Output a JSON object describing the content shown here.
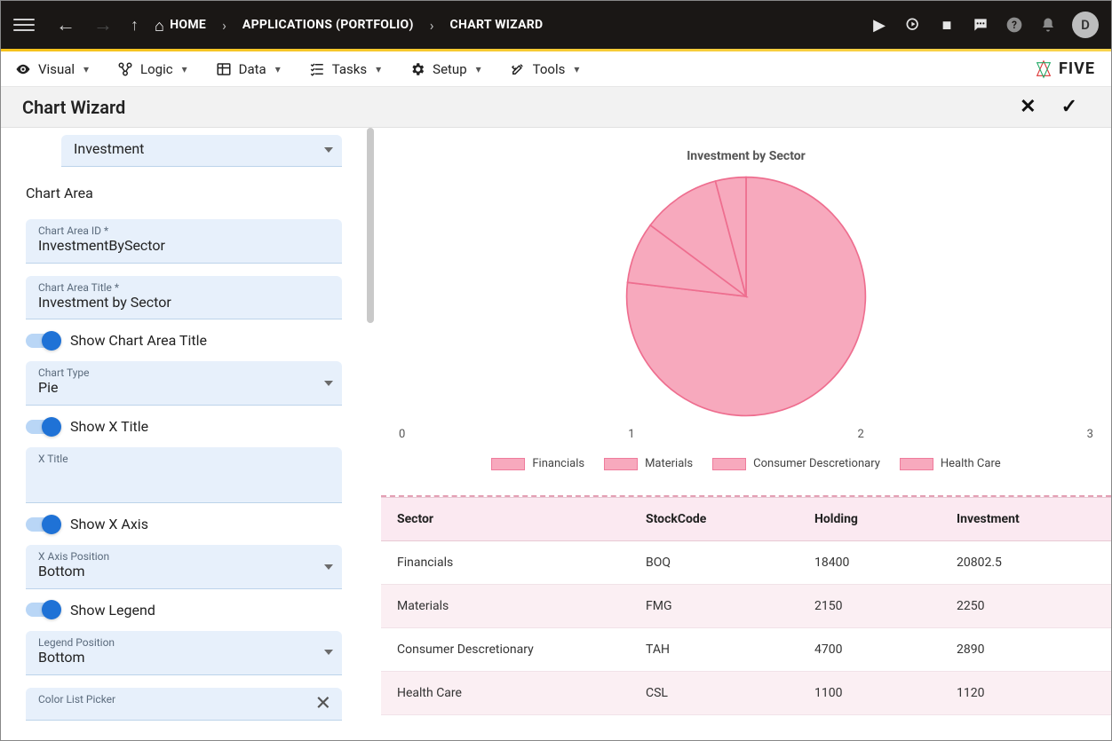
{
  "topnav": {
    "breadcrumbs": [
      {
        "label": "HOME",
        "icon": "home"
      },
      {
        "label": "APPLICATIONS (PORTFOLIO)"
      },
      {
        "label": "CHART WIZARD"
      }
    ],
    "avatar_initial": "D"
  },
  "toolbar": {
    "items": [
      {
        "label": "Visual"
      },
      {
        "label": "Logic"
      },
      {
        "label": "Data"
      },
      {
        "label": "Tasks"
      },
      {
        "label": "Setup"
      },
      {
        "label": "Tools"
      }
    ],
    "logo_text": "FIVE"
  },
  "page": {
    "title": "Chart Wizard"
  },
  "form": {
    "dataset_value": "Investment",
    "section_label": "Chart Area",
    "chart_area_id": {
      "label": "Chart Area ID *",
      "value": "InvestmentBySector"
    },
    "chart_area_title": {
      "label": "Chart Area Title *",
      "value": "Investment by Sector"
    },
    "show_chart_area_title_label": "Show Chart Area Title",
    "chart_type": {
      "label": "Chart Type",
      "value": "Pie"
    },
    "show_x_title_label": "Show X Title",
    "x_title": {
      "label": "X Title",
      "value": ""
    },
    "show_x_axis_label": "Show X Axis",
    "x_axis_position": {
      "label": "X Axis Position",
      "value": "Bottom"
    },
    "show_legend_label": "Show Legend",
    "legend_position": {
      "label": "Legend Position",
      "value": "Bottom"
    },
    "color_list_picker": {
      "label": "Color List Picker",
      "value": ""
    }
  },
  "chart": {
    "title": "Investment by Sector",
    "axis_ticks": [
      "0",
      "1",
      "2",
      "3"
    ],
    "legend": [
      "Financials",
      "Materials",
      "Consumer Descretionary",
      "Health Care"
    ],
    "color": "#f7a9bd",
    "stroke": "#ee6e8f"
  },
  "table": {
    "headers": [
      "Sector",
      "StockCode",
      "Holding",
      "Investment"
    ],
    "rows": [
      [
        "Financials",
        "BOQ",
        "18400",
        "20802.5"
      ],
      [
        "Materials",
        "FMG",
        "2150",
        "2250"
      ],
      [
        "Consumer Descretionary",
        "TAH",
        "4700",
        "2890"
      ],
      [
        "Health Care",
        "CSL",
        "1100",
        "1120"
      ]
    ]
  },
  "chart_data": {
    "type": "pie",
    "title": "Investment by Sector",
    "categories": [
      "Financials",
      "Materials",
      "Consumer Descretionary",
      "Health Care"
    ],
    "values": [
      20802.5,
      2250,
      2890,
      1120
    ],
    "legend_position": "bottom",
    "xaxis_ticks": [
      0,
      1,
      2,
      3
    ]
  }
}
